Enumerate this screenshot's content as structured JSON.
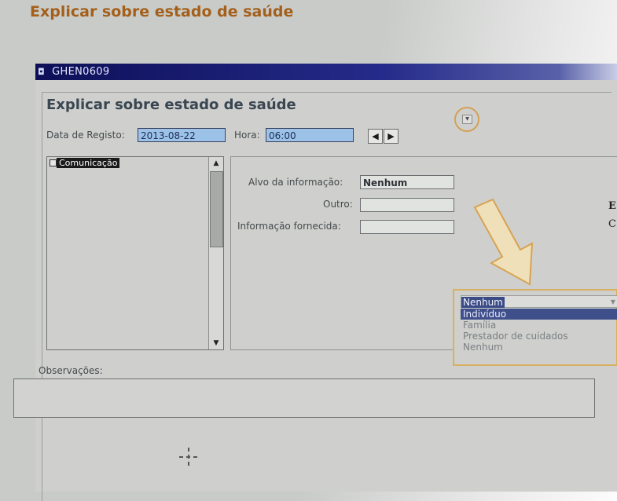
{
  "page_heading": "Explicar sobre estado de saúde",
  "window": {
    "title": "GHEN0609",
    "icon": "window-icon"
  },
  "form": {
    "title": "Explicar sobre estado de saúde",
    "date_label": "Data de Registo:",
    "date_value": "2013-08-22",
    "time_label": "Hora:",
    "time_value": "06:00",
    "nav_prev": "◀",
    "nav_next": "▶"
  },
  "tree": {
    "item_label": "Comunicação"
  },
  "info": {
    "target_label": "Alvo da informação:",
    "target_value": "Nenhum",
    "other_label": "Outro:",
    "provided_label": "Informação fornecida:"
  },
  "dropdown": {
    "selected": "Nenhum",
    "options": [
      "Indivíduo",
      "Família",
      "Prestador de cuidados",
      "Nenhum"
    ],
    "active_index": 0
  },
  "observations_label": "Observações:",
  "edge_text": [
    "E",
    "C"
  ],
  "colors": {
    "heading": "#a4601b",
    "title_bar": "#0d0f57",
    "highlight_field": "#9cc3e7",
    "annotation": "#d9b060"
  }
}
